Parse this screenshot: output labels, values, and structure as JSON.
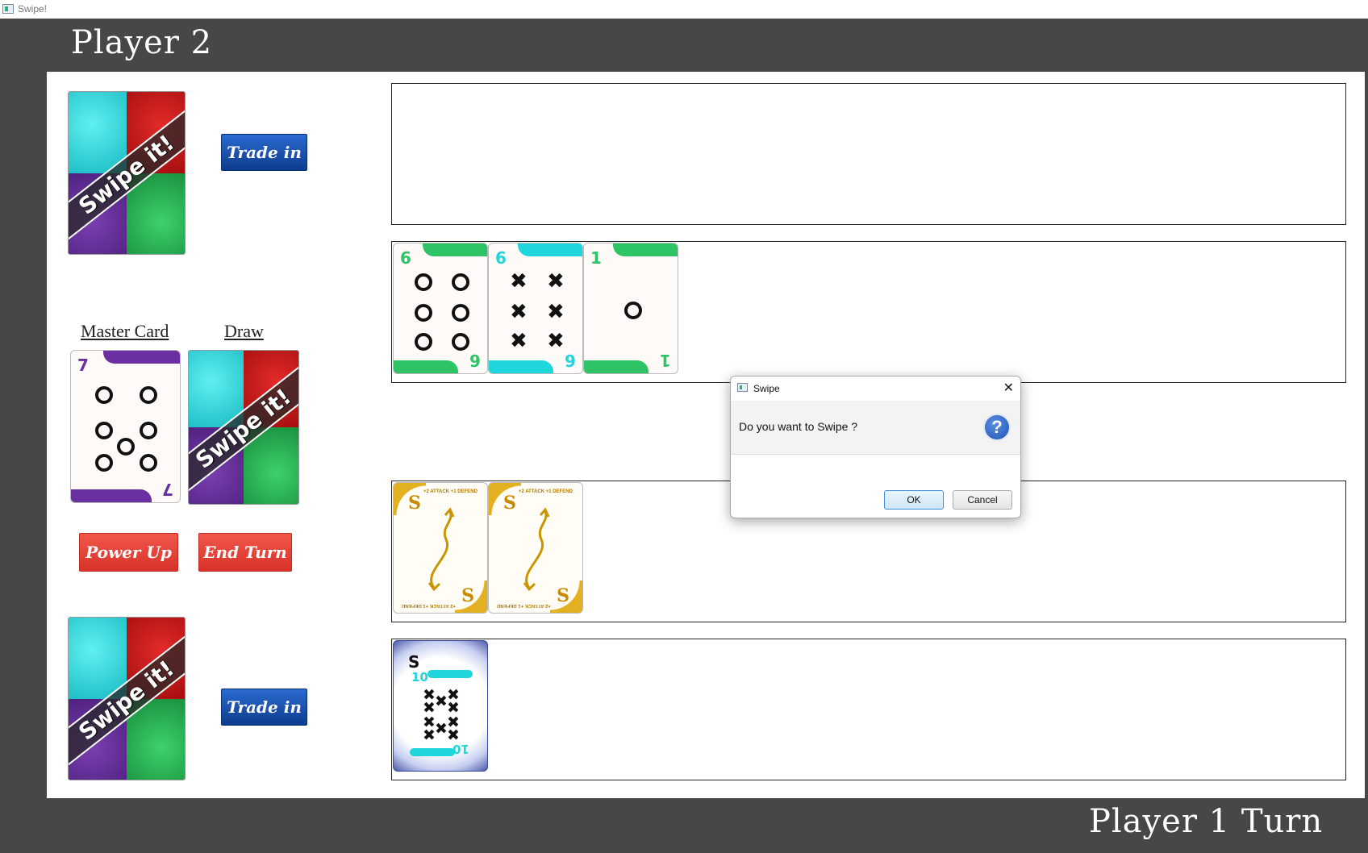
{
  "window": {
    "title": "Swipe!"
  },
  "labels": {
    "opponent": "Player 2",
    "turn": "Player 1 Turn",
    "master_card": "Master Card",
    "draw": "Draw"
  },
  "buttons": {
    "trade_in_top": "Trade in",
    "trade_in_bottom": "Trade in",
    "power_up": "Power Up",
    "end_turn": "End Turn"
  },
  "card_back": {
    "text": "Swipe it!"
  },
  "master_card": {
    "rank": "7",
    "pips": "o",
    "color": "#6a2fa0"
  },
  "zone2_cards": [
    {
      "rank": "6",
      "symbol": "o",
      "color": "#2ec466"
    },
    {
      "rank": "6",
      "symbol": "x",
      "color": "#1fd6dc"
    },
    {
      "rank": "1",
      "symbol": "o",
      "color": "#2ec466"
    }
  ],
  "zone3_cards": [
    {
      "letter": "S",
      "text": "+2 ATTACK +1 DEFEND"
    },
    {
      "letter": "S",
      "text": "+2 ATTACK +1 DEFEND"
    }
  ],
  "zone4_card": {
    "letter": "S",
    "rank": "10",
    "symbol": "x",
    "color": "#1fd6dc"
  },
  "dialog": {
    "title": "Swipe",
    "message": "Do you want to Swipe ?",
    "ok": "OK",
    "cancel": "Cancel",
    "close": "✕"
  }
}
